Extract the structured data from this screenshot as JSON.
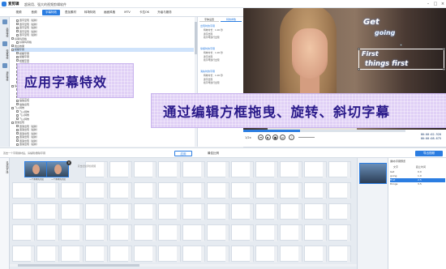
{
  "app": {
    "name": "爱剪辑",
    "subtitle": "超易用、强大的视频剪辑软件"
  },
  "toolbar": {
    "tabs": [
      {
        "label": "视频"
      },
      {
        "label": "音频"
      },
      {
        "label": "字幕特效"
      },
      {
        "label": "叠加素材"
      },
      {
        "label": "转场特效"
      },
      {
        "label": "画面风格"
      },
      {
        "label": "MTV"
      },
      {
        "label": "卡拉OK"
      },
      {
        "label": "升级与服务"
      }
    ]
  },
  "sidebar": {
    "tabs": [
      {
        "label": "出现特效"
      },
      {
        "label": "停留特效"
      },
      {
        "label": "消失特效"
      }
    ]
  },
  "tree": {
    "rows": [
      "逐字显现（最新）",
      "逐字显现（最新）",
      "逐字显现（最新）",
      "逐字显现（最新）",
      "逐字显现（最新）",
      "好莱坞风格",
      "好莱坞风格",
      "舞台效果",
      "模糊字幕",
      "模糊字幕",
      "模糊字幕",
      "模糊字幕",
      "模糊字幕",
      "模糊字幕",
      "模糊字幕",
      "模糊字幕",
      "模糊字幕",
      "模糊字幕",
      "缩放出现",
      "缩放出现",
      "缩放出现",
      "缩放出现",
      "缩放出现",
      "缩放出现",
      "飞入特效",
      "飞入特效",
      "飞入特效",
      "飞入特效",
      "逐渐出现",
      "逐渐出现（最新）",
      "逐渐出现（最新）",
      "逐渐出现（最新）",
      "逐渐出现（最新）",
      "逐渐出现（最新）",
      "逐渐出现（最新）"
    ]
  },
  "settings": {
    "tabs": [
      {
        "label": "字体设置"
      },
      {
        "label": "特效参数"
      }
    ],
    "groups": [
      {
        "title": "出现时的字幕",
        "lines": [
          "特效时长：1.00 秒",
          "逐字出现",
          "按字母逐行出现"
        ]
      },
      {
        "title": "停留时的字幕",
        "lines": [
          "特效时长：1.00 秒",
          "逐字出现",
          "按字母逐行出现"
        ]
      },
      {
        "title": "消失时的字幕",
        "lines": [
          "特效时长：1.00 秒",
          "逐字出现",
          "按字母逐行出现"
        ]
      }
    ]
  },
  "preview": {
    "captions": [
      "Get",
      "going",
      "First",
      "things first"
    ]
  },
  "controls": {
    "speed_label": "1/2x",
    "time_current": "00:00:02.920",
    "time_total": "00:00:08.675",
    "progress_pct": 35
  },
  "banners": {
    "banner1": "应用字幕特效",
    "banner2": "通过编辑方框拖曳、旋转、斜切字幕"
  },
  "bar2": {
    "hint": "双击一个字幕素材后，请编辑/删除字幕",
    "apply_label": "应用",
    "fit_label": "最佳比例",
    "export_label": "导出视频"
  },
  "timeline": {
    "side_tabs": [
      "已添加片段"
    ],
    "clips": [
      {
        "label": "一个素材的片段"
      },
      {
        "label": "一个素材的片段"
      }
    ],
    "dropzone_text": "双击此处添加视频"
  },
  "subpanel": {
    "title": "素材/字幕预览",
    "col1": "文字",
    "col2": "起止时间",
    "rows": [
      {
        "text": "Get",
        "time": "0.0"
      },
      {
        "text": "going",
        "time": "1.0"
      },
      {
        "text": "First",
        "time": "2.5"
      },
      {
        "text": "things",
        "time": "3.5"
      }
    ]
  },
  "colors": {
    "accent": "#2b7de1",
    "banner_bg": "#e0d0f6",
    "banner_text": "#2a1a8a"
  }
}
